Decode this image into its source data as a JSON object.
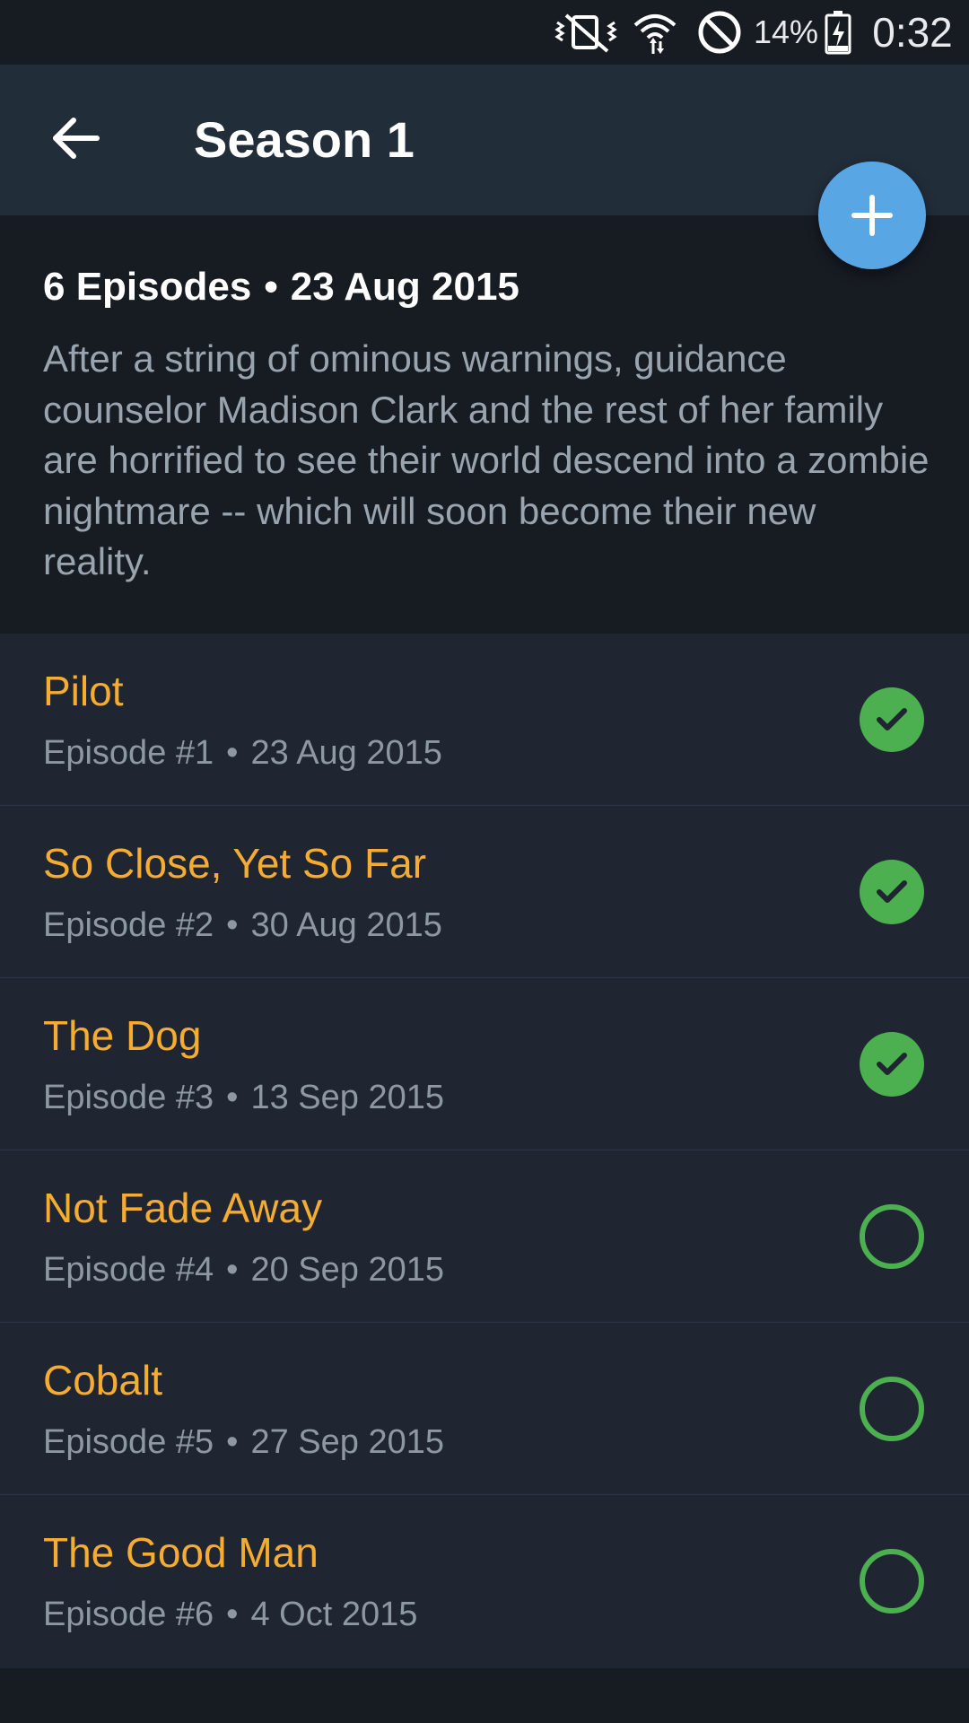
{
  "status_bar": {
    "battery_percent": "14%",
    "clock": "0:32",
    "icons": [
      "vibrate-icon",
      "wifi-icon",
      "do-not-disturb-icon",
      "battery-charging-icon"
    ]
  },
  "app_bar": {
    "title": "Season 1",
    "back_icon": "arrow-left-icon"
  },
  "fab": {
    "icon": "plus-icon",
    "color": "#58a6e4"
  },
  "season": {
    "episode_count": "6 Episodes",
    "separator": "•",
    "air_date": "23 Aug 2015",
    "overview": "After a string of ominous warnings, guidance counselor Madison Clark and the rest of her family are horrified to see their world descend into a zombie nightmare -- which will soon become their new reality."
  },
  "colors": {
    "accent_title": "#f5ac30",
    "watched_green": "#4caf50",
    "app_bar_bg": "#222d3a",
    "list_bg": "#1f2631"
  },
  "episodes": [
    {
      "title": "Pilot",
      "number": "Episode #1",
      "separator": "•",
      "date": "23 Aug 2015",
      "watched": true
    },
    {
      "title": "So Close, Yet So Far",
      "number": "Episode #2",
      "separator": "•",
      "date": "30 Aug 2015",
      "watched": true
    },
    {
      "title": "The Dog",
      "number": "Episode #3",
      "separator": "•",
      "date": "13 Sep 2015",
      "watched": true
    },
    {
      "title": "Not Fade Away",
      "number": "Episode #4",
      "separator": "•",
      "date": "20 Sep 2015",
      "watched": false
    },
    {
      "title": "Cobalt",
      "number": "Episode #5",
      "separator": "•",
      "date": "27 Sep 2015",
      "watched": false
    },
    {
      "title": "The Good Man",
      "number": "Episode #6",
      "separator": "•",
      "date": "4 Oct 2015",
      "watched": false
    }
  ]
}
